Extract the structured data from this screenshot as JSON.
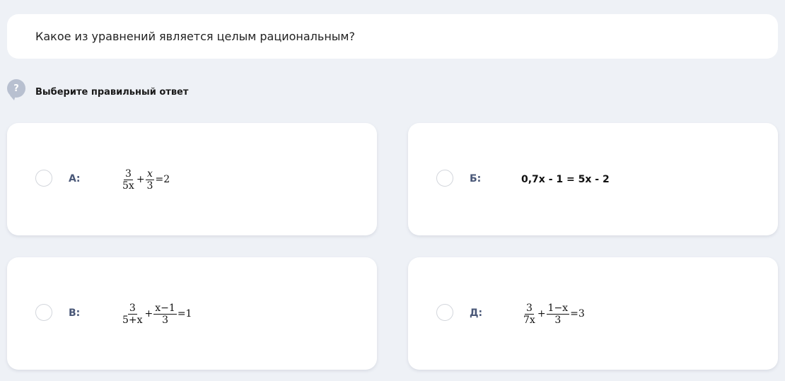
{
  "question": {
    "text": "Какое из уравнений является целым рациональным?"
  },
  "hint": {
    "icon": "?",
    "text": "Выберите правильный ответ"
  },
  "options": [
    {
      "letter": "А:",
      "formula": {
        "f1_num": "3",
        "f1_den": "5x",
        "op1": "+",
        "f2_num": "x",
        "f2_den": "3",
        "rhs": "=2"
      }
    },
    {
      "letter": "Б:",
      "formula_text": "0,7x - 1 = 5x - 2"
    },
    {
      "letter": "В:",
      "formula": {
        "f1_num": "3",
        "f1_den": "5+x",
        "op1": "+",
        "f2_num": "x−1",
        "f2_den": "3",
        "rhs": "=1"
      }
    },
    {
      "letter": "Д:",
      "formula": {
        "f1_num": "3",
        "f1_den": "7x",
        "op1": "+",
        "f2_num": "1−x",
        "f2_den": "3",
        "rhs": "=3"
      }
    }
  ]
}
